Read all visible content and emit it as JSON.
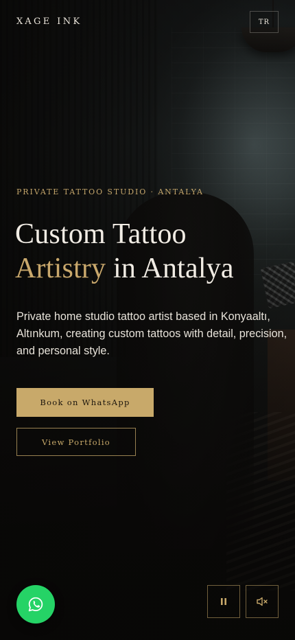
{
  "header": {
    "brand": "XAGE INK",
    "language_toggle": "TR"
  },
  "hero": {
    "eyebrow": "PRIVATE TATTOO STUDIO · ANTALYA",
    "headline_line1": "Custom Tattoo",
    "headline_accent": "Artistry",
    "headline_rest": " in Antalya",
    "description": "Private home studio tattoo artist based in Konyaaltı, Altınkum, creating custom tattoos with detail, precision, and personal style."
  },
  "actions": {
    "primary_label": "Book on WhatsApp",
    "secondary_label": "View Portfolio"
  },
  "floating": {
    "whatsapp_icon": "whatsapp-icon",
    "pause_icon": "pause-icon",
    "mute_icon": "volume-mute-icon"
  },
  "colors": {
    "accent_gold": "#c8a96a",
    "whatsapp_green": "#25d366",
    "background": "#0b0a09",
    "text_light": "#ece6dc"
  }
}
